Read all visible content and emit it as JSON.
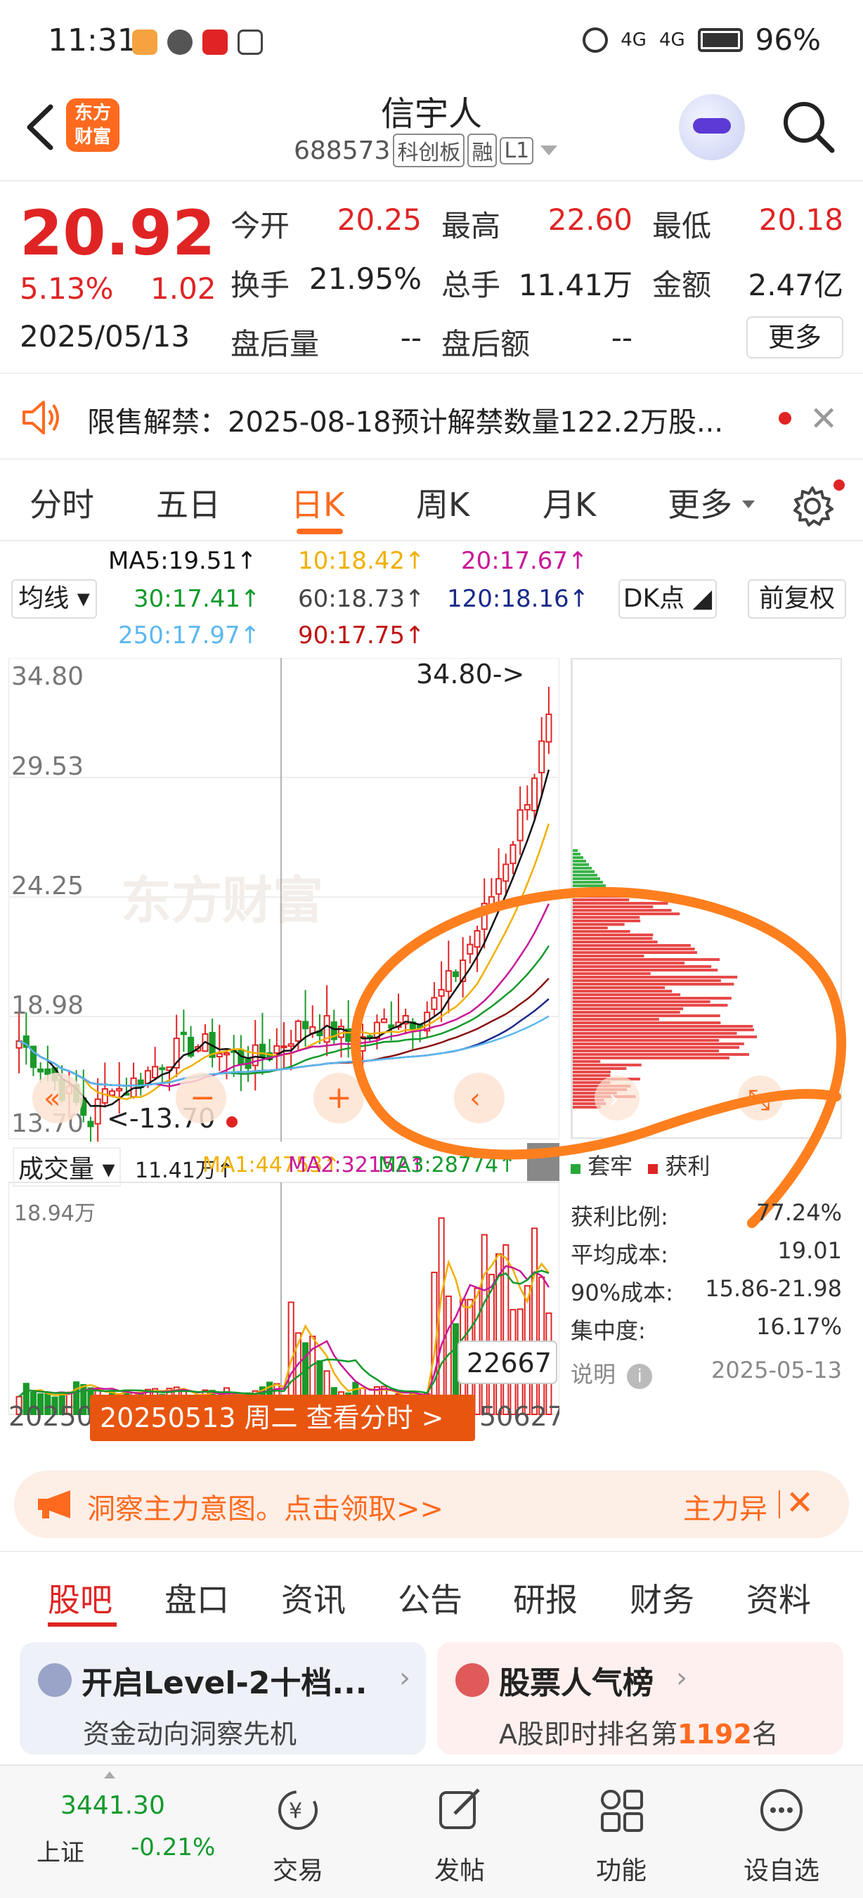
{
  "status_bar": {
    "time": "11:31",
    "battery": "96%",
    "net1": "4G",
    "net2": "4G"
  },
  "header": {
    "stock_name": "信宇人",
    "stock_code": "688573",
    "tags": [
      "科创板",
      "融",
      "L1"
    ],
    "logo_text": "东方\n财富"
  },
  "quote": {
    "price": "20.92",
    "change_pct": "5.13%",
    "change": "1.02",
    "date": "2025/05/13",
    "open_label": "今开",
    "open": "20.25",
    "high_label": "最高",
    "high": "22.60",
    "low_label": "最低",
    "low": "20.18",
    "turnover_label": "换手",
    "turnover": "21.95%",
    "volume_label": "总手",
    "volume": "11.41万",
    "amount_label": "金额",
    "amount": "2.47亿",
    "after_vol_label": "盘后量",
    "after_vol": "--",
    "after_amt_label": "盘后额",
    "after_amt": "--",
    "more_label": "更多"
  },
  "notice": {
    "text": "限售解禁：2025-08-18预计解禁数量122.2万股..."
  },
  "period_tabs": {
    "items": [
      "分时",
      "五日",
      "日K",
      "周K",
      "月K",
      "更多"
    ],
    "active": "日K"
  },
  "ma_legend": {
    "ma_type": "均线",
    "ma5": "MA5:19.51↑",
    "ma10": "10:18.42↑",
    "ma20": "20:17.67↑",
    "ma30": "30:17.41↑",
    "ma60": "60:18.73↑",
    "ma120": "120:18.16↑",
    "ma250": "250:17.97↑",
    "ma90": "90:17.75↑",
    "dk_label": "DK点",
    "adjust_label": "前复权"
  },
  "kchart": {
    "y_labels": [
      "34.80",
      "29.53",
      "24.25",
      "18.98",
      "13.70"
    ],
    "max_marker": "34.80->",
    "min_marker": "<-13.70",
    "watermark": "东方财富",
    "volume_title": "成交量",
    "volume_now": "11.41万↑",
    "vma1": "MA1:44753↑",
    "vma2": "MA2:32152↑",
    "vma3": "MA3:28774↑",
    "volume_max": "18.94万",
    "cursor_value": "22667",
    "date_left": "20250",
    "date_right": "50627",
    "date_tooltip": "20250513 周二 查看分时 >",
    "colors": {
      "up": "#e02424",
      "down": "#1a9a2a",
      "ma5": "#111111",
      "ma10": "#f0b000",
      "ma20": "#c8189a",
      "ma60": "#8a1010",
      "ma120": "#1a2a8a",
      "ma250": "#5bb8f0",
      "annotation": "#ff7f1e"
    }
  },
  "chip": {
    "legend_trap": "套牢",
    "legend_profit": "获利",
    "profit_ratio_label": "获利比例:",
    "profit_ratio": "77.24%",
    "avg_cost_label": "平均成本:",
    "avg_cost": "19.01",
    "cost90_label": "90%成本:",
    "cost90": "15.86-21.98",
    "concentration_label": "集中度:",
    "concentration": "16.17%",
    "note_label": "说明",
    "note_date": "2025-05-13"
  },
  "promo": {
    "text": "洞察主力意图。点击领取>>",
    "right": "主力异"
  },
  "info_tabs": {
    "items": [
      "股吧",
      "盘口",
      "资讯",
      "公告",
      "研报",
      "财务",
      "资料"
    ],
    "active": "股吧"
  },
  "cards": {
    "level2_title": "开启Level-2十档...",
    "level2_sub": "资金动向洞察先机",
    "rank_title": "股票人气榜",
    "rank_sub_prefix": "A股即时排名第",
    "rank_num": "1192",
    "rank_sub_suffix": "名"
  },
  "bottom_nav": {
    "index_value": "3441.30",
    "index_name": "上证",
    "index_change": "-0.21%",
    "items": [
      "交易",
      "发帖",
      "功能",
      "设自选"
    ]
  }
}
